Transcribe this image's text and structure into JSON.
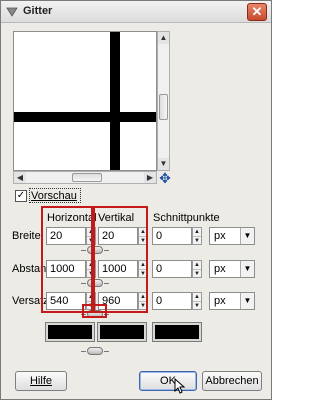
{
  "window": {
    "title": "Gitter"
  },
  "preview": {
    "checkbox_label": "Vorschau",
    "checked": true
  },
  "columns": {
    "horizontal": "Horizontal",
    "vertical": "Vertikal",
    "intersections": "Schnittpunkte"
  },
  "rows": [
    {
      "label": "Breite:",
      "horizontal": "20",
      "vertical": "20",
      "intersection": "0",
      "unit": "px"
    },
    {
      "label": "Abstand:",
      "horizontal": "1000",
      "vertical": "1000",
      "intersection": "0",
      "unit": "px"
    },
    {
      "label": "Versatz:",
      "horizontal": "540",
      "vertical": "960",
      "intersection": "0",
      "unit": "px"
    }
  ],
  "colors": {
    "swatch_horizontal": "#000000",
    "swatch_vertical": "#000000",
    "swatch_intersection": "#000000",
    "highlight": "#c41a1a"
  },
  "buttons": {
    "help": "Hilfe",
    "ok": "OK",
    "cancel": "Abbrechen"
  },
  "icons": {
    "close": "close-icon",
    "navigate": "navigate-icon",
    "chain": "chain-link-icon"
  }
}
